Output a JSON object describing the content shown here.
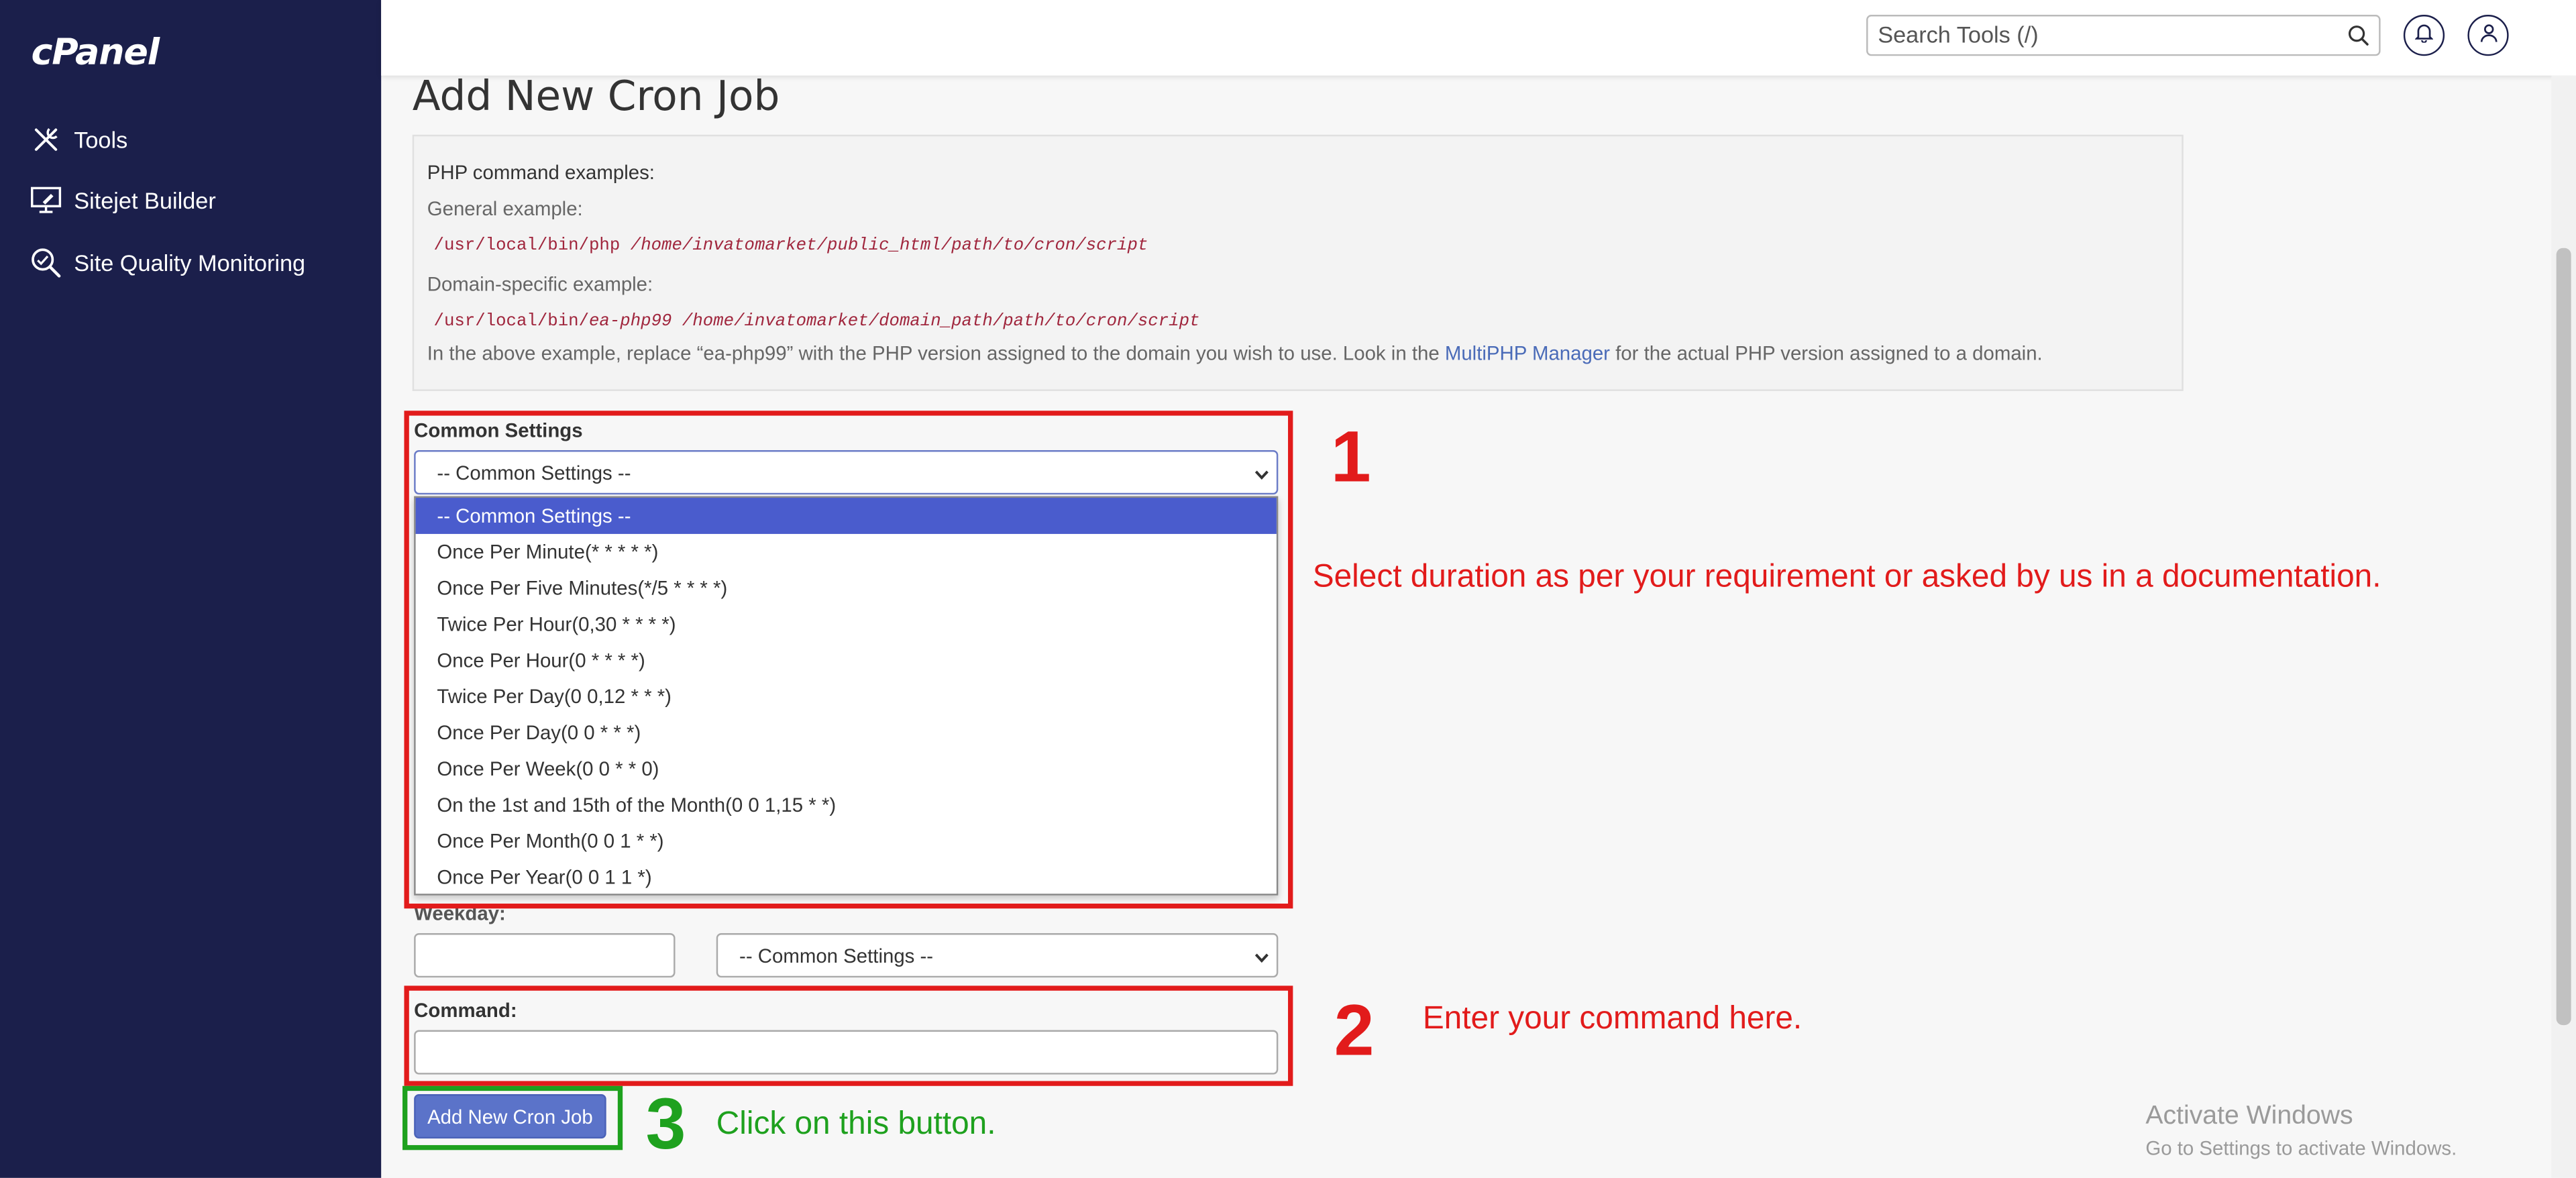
{
  "app": {
    "logo": "cPanel"
  },
  "sidebar": {
    "items": [
      {
        "label": "Tools",
        "icon": "tools-icon"
      },
      {
        "label": "Sitejet Builder",
        "icon": "monitor-pen-icon"
      },
      {
        "label": "Site Quality Monitoring",
        "icon": "magnifier-icon"
      }
    ]
  },
  "header": {
    "search_placeholder": "Search Tools (/)"
  },
  "page": {
    "title": "Add New Cron Job"
  },
  "examples": {
    "heading": "PHP command examples:",
    "general_label": "General example:",
    "general_cmd_plain": "/usr/local/bin/php ",
    "general_cmd_italic": "/home/invatomarket/public_html/path/to/cron/script",
    "domain_label": "Domain-specific example:",
    "domain_cmd_plain": "/usr/local/bin/",
    "domain_cmd_italic": "ea-php99 /home/invatomarket/domain_path/path/to/cron/script",
    "note_before": "In the above example, replace “ea-php99” with the PHP version assigned to the domain you wish to use. Look in the ",
    "note_link": "MultiPHP Manager",
    "note_after": " for the actual PHP version assigned to a domain."
  },
  "form": {
    "common_settings_label": "Common Settings",
    "common_settings_selected": "-- Common Settings --",
    "options": [
      "-- Common Settings --",
      "Once Per Minute(* * * * *)",
      "Once Per Five Minutes(*/5 * * * *)",
      "Twice Per Hour(0,30 * * * *)",
      "Once Per Hour(0 * * * *)",
      "Twice Per Day(0 0,12 * * *)",
      "Once Per Day(0 0 * * *)",
      "Once Per Week(0 0 * * 0)",
      "On the 1st and 15th of the Month(0 0 1,15 * *)",
      "Once Per Month(0 0 1 * *)",
      "Once Per Year(0 0 1 1 *)"
    ],
    "weekday_label": "Weekday:",
    "weekday_select": "-- Common Settings --",
    "command_label": "Command:",
    "submit_label": "Add New Cron Job"
  },
  "annotations": {
    "step1_num": "1",
    "step1_text": "Select duration as per your requirement or asked by us in a documentation.",
    "step2_num": "2",
    "step2_text": "Enter your command here.",
    "step3_num": "3",
    "step3_text": "Click on this button.",
    "colors": {
      "red": "#e21b1b",
      "green": "#1ea11e"
    }
  },
  "watermark": {
    "line1": "Activate Windows",
    "line2": "Go to Settings to activate Windows."
  }
}
